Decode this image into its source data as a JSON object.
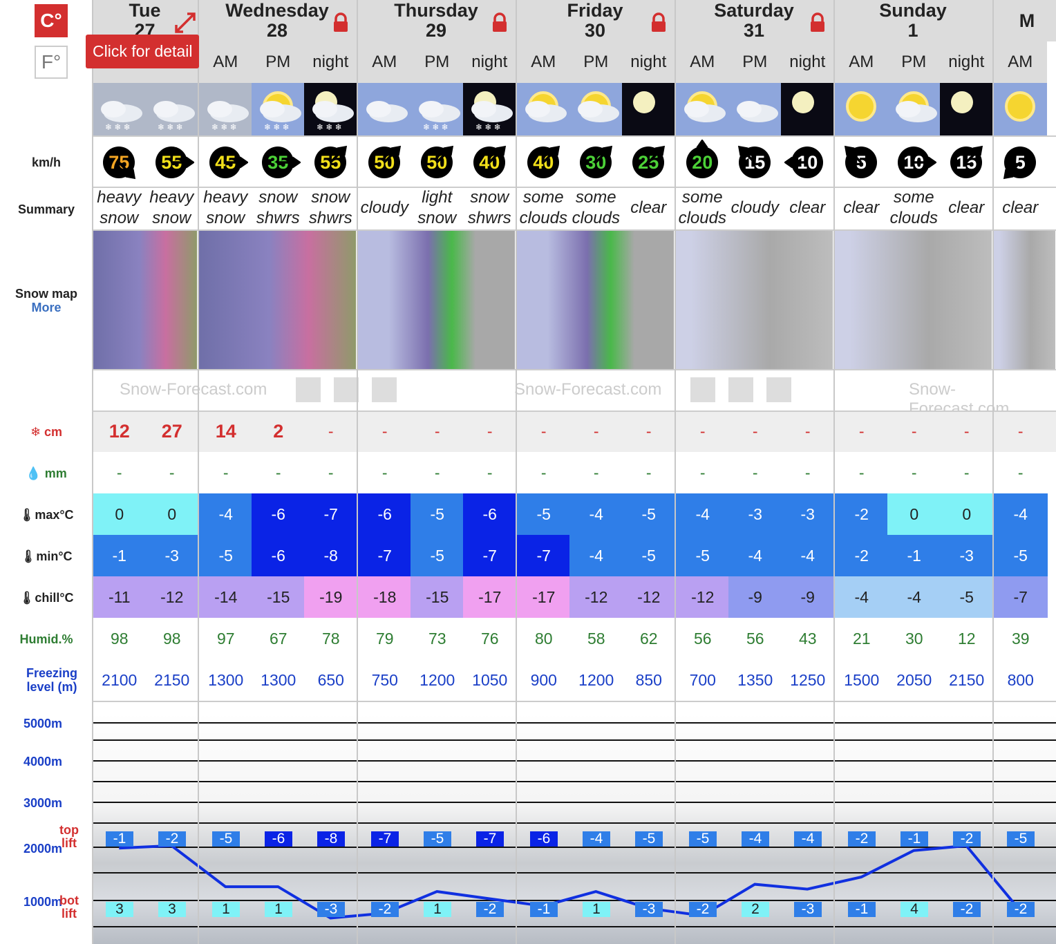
{
  "units": {
    "c": "C°",
    "f": "F°"
  },
  "tooltip": "Click for detail",
  "labels": {
    "wind": "km/h",
    "summary": "Summary",
    "snowmap": "Snow map",
    "more": "More",
    "snow": "cm",
    "rain": "mm",
    "max": "max°C",
    "min": "min°C",
    "chill": "chill°C",
    "humid": "Humid.%",
    "freezing": "Freezing level (m)",
    "alt5000": "5000m",
    "alt4000": "4000m",
    "alt3000": "3000m",
    "alt2000": "2000m",
    "alt1000": "1000m",
    "toplift": "top lift",
    "botlift": "bot lift"
  },
  "watermark": "Snow-Forecast.com",
  "days": [
    {
      "name": "Tue",
      "date": "27",
      "periods": 2,
      "locked": false
    },
    {
      "name": "Wednesday",
      "date": "28",
      "periods": 3,
      "locked": true
    },
    {
      "name": "Thursday",
      "date": "29",
      "periods": 3,
      "locked": true
    },
    {
      "name": "Friday",
      "date": "30",
      "periods": 3,
      "locked": true
    },
    {
      "name": "Saturday",
      "date": "31",
      "periods": 3,
      "locked": true
    },
    {
      "name": "Sunday",
      "date": "1",
      "periods": 3,
      "locked": false
    },
    {
      "name": "M",
      "date": "",
      "periods": 1,
      "locked": false
    }
  ],
  "columns": [
    {
      "period": "",
      "icon": "heavy-snow",
      "wind": "75",
      "wdir": "se",
      "wcol": "orange",
      "summary": "heavy snow",
      "snow": "12",
      "rain": "-",
      "max": "0",
      "min": "-1",
      "chill": "-11",
      "humid": "98",
      "freeze": "2100",
      "top": "-1",
      "bot": "3"
    },
    {
      "period": "",
      "icon": "heavy-snow",
      "wind": "55",
      "wdir": "e",
      "wcol": "yellow",
      "summary": "heavy snow",
      "snow": "27",
      "rain": "-",
      "max": "0",
      "min": "-3",
      "chill": "-12",
      "humid": "98",
      "freeze": "2150",
      "top": "-2",
      "bot": "3"
    },
    {
      "period": "AM",
      "icon": "heavy-snow",
      "wind": "45",
      "wdir": "e",
      "wcol": "yellow",
      "summary": "heavy snow",
      "snow": "14",
      "rain": "-",
      "max": "-4",
      "min": "-5",
      "chill": "-14",
      "humid": "97",
      "freeze": "1300",
      "top": "-5",
      "bot": "1"
    },
    {
      "period": "PM",
      "icon": "snow-showers-day",
      "wind": "35",
      "wdir": "e",
      "wcol": "green",
      "summary": "snow shwrs",
      "snow": "2",
      "rain": "-",
      "max": "-6",
      "min": "-6",
      "chill": "-15",
      "humid": "67",
      "freeze": "1300",
      "top": "-6",
      "bot": "1"
    },
    {
      "period": "night",
      "icon": "snow-showers-night",
      "wind": "55",
      "wdir": "ne",
      "wcol": "yellow",
      "summary": "snow shwrs",
      "snow": "-",
      "rain": "-",
      "max": "-7",
      "min": "-8",
      "chill": "-19",
      "humid": "78",
      "freeze": "650",
      "top": "-8",
      "bot": "-3"
    },
    {
      "period": "AM",
      "icon": "cloudy",
      "wind": "50",
      "wdir": "ne",
      "wcol": "yellow",
      "summary": "cloudy",
      "snow": "-",
      "rain": "-",
      "max": "-6",
      "min": "-7",
      "chill": "-18",
      "humid": "79",
      "freeze": "750",
      "top": "-7",
      "bot": "-2"
    },
    {
      "period": "PM",
      "icon": "light-snow",
      "wind": "50",
      "wdir": "ne",
      "wcol": "yellow",
      "summary": "light snow",
      "snow": "-",
      "rain": "-",
      "max": "-5",
      "min": "-5",
      "chill": "-15",
      "humid": "73",
      "freeze": "1200",
      "top": "-5",
      "bot": "1"
    },
    {
      "period": "night",
      "icon": "snow-showers-night",
      "wind": "40",
      "wdir": "ne",
      "wcol": "yellow",
      "summary": "snow shwrs",
      "snow": "-",
      "rain": "-",
      "max": "-6",
      "min": "-7",
      "chill": "-17",
      "humid": "76",
      "freeze": "1050",
      "top": "-7",
      "bot": "-2"
    },
    {
      "period": "AM",
      "icon": "some-clouds",
      "wind": "40",
      "wdir": "ne",
      "wcol": "yellow",
      "summary": "some clouds",
      "snow": "-",
      "rain": "-",
      "max": "-5",
      "min": "-7",
      "chill": "-17",
      "humid": "80",
      "freeze": "900",
      "top": "-6",
      "bot": "-1"
    },
    {
      "period": "PM",
      "icon": "some-clouds",
      "wind": "30",
      "wdir": "ne",
      "wcol": "green",
      "summary": "some clouds",
      "snow": "-",
      "rain": "-",
      "max": "-4",
      "min": "-4",
      "chill": "-12",
      "humid": "58",
      "freeze": "1200",
      "top": "-4",
      "bot": "1"
    },
    {
      "period": "night",
      "icon": "clear-night",
      "wind": "25",
      "wdir": "ne",
      "wcol": "green",
      "summary": "clear",
      "snow": "-",
      "rain": "-",
      "max": "-5",
      "min": "-5",
      "chill": "-12",
      "humid": "62",
      "freeze": "850",
      "top": "-5",
      "bot": "-3"
    },
    {
      "period": "AM",
      "icon": "some-clouds",
      "wind": "20",
      "wdir": "n",
      "wcol": "green",
      "summary": "some clouds",
      "snow": "-",
      "rain": "-",
      "max": "-4",
      "min": "-5",
      "chill": "-12",
      "humid": "56",
      "freeze": "700",
      "top": "-5",
      "bot": "-2"
    },
    {
      "period": "PM",
      "icon": "cloudy",
      "wind": "15",
      "wdir": "nw",
      "wcol": "white",
      "summary": "cloudy",
      "snow": "-",
      "rain": "-",
      "max": "-3",
      "min": "-4",
      "chill": "-9",
      "humid": "56",
      "freeze": "1350",
      "top": "-4",
      "bot": "2"
    },
    {
      "period": "night",
      "icon": "clear-night",
      "wind": "10",
      "wdir": "w",
      "wcol": "white",
      "summary": "clear",
      "snow": "-",
      "rain": "-",
      "max": "-3",
      "min": "-4",
      "chill": "-9",
      "humid": "43",
      "freeze": "1250",
      "top": "-4",
      "bot": "-3"
    },
    {
      "period": "AM",
      "icon": "clear-day",
      "wind": "5",
      "wdir": "nw",
      "wcol": "white",
      "summary": "clear",
      "snow": "-",
      "rain": "-",
      "max": "-2",
      "min": "-2",
      "chill": "-4",
      "humid": "21",
      "freeze": "1500",
      "top": "-2",
      "bot": "-1"
    },
    {
      "period": "PM",
      "icon": "some-clouds",
      "wind": "10",
      "wdir": "e",
      "wcol": "white",
      "summary": "some clouds",
      "snow": "-",
      "rain": "-",
      "max": "0",
      "min": "-1",
      "chill": "-4",
      "humid": "30",
      "freeze": "2050",
      "top": "-1",
      "bot": "4"
    },
    {
      "period": "night",
      "icon": "clear-night",
      "wind": "15",
      "wdir": "ne",
      "wcol": "white",
      "summary": "clear",
      "snow": "-",
      "rain": "-",
      "max": "0",
      "min": "-3",
      "chill": "-5",
      "humid": "12",
      "freeze": "2150",
      "top": "-2",
      "bot": "-2"
    },
    {
      "period": "AM",
      "icon": "clear-day",
      "wind": "5",
      "wdir": "sw",
      "wcol": "white",
      "summary": "clear",
      "snow": "-",
      "rain": "-",
      "max": "-4",
      "min": "-5",
      "chill": "-7",
      "humid": "39",
      "freeze": "800",
      "top": "-5",
      "bot": "-2"
    }
  ],
  "colors": {
    "accent": "#d32f2f",
    "humid": "#2e7d32",
    "freeze": "#1a3fc7",
    "altitude": "#1a3fc7",
    "line": "#1030e0"
  }
}
